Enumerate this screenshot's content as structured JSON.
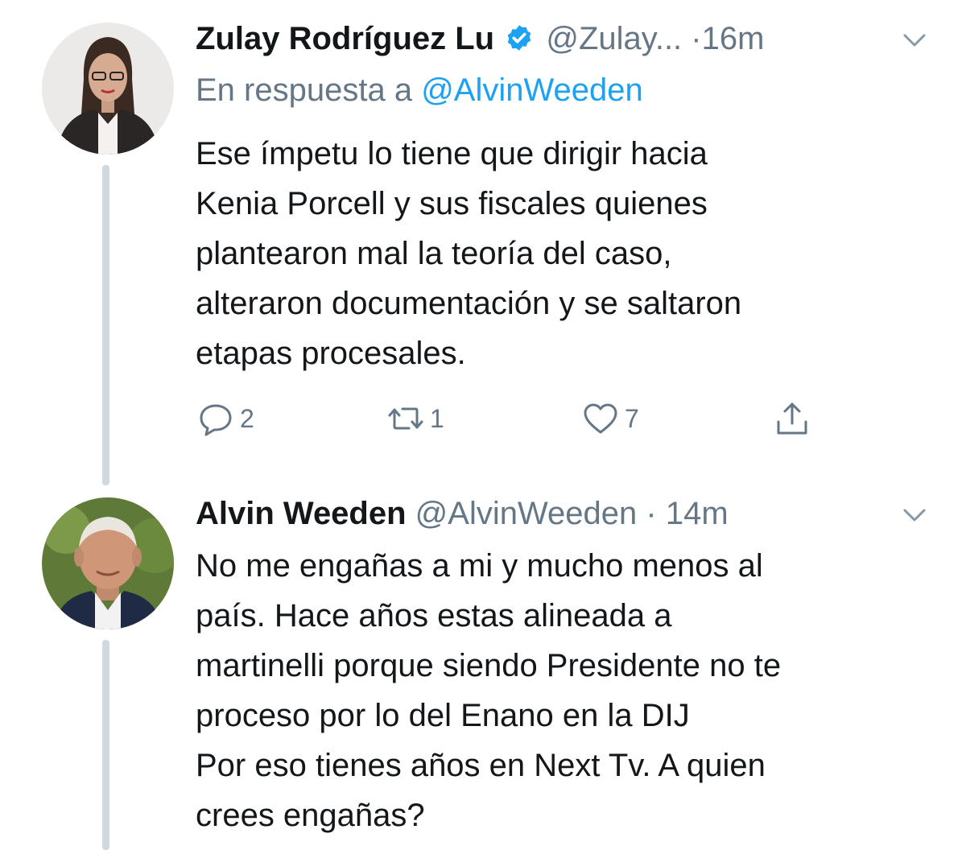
{
  "tweets": [
    {
      "name": "Zulay Rodríguez Lu",
      "handle": "@Zulay...",
      "separator": "·",
      "time": "16m",
      "reply_prefix": "En respuesta a",
      "reply_handle": "@AlvinWeeden",
      "text": "Ese ímpetu lo tiene que dirigir hacia\nKenia Porcell y sus fiscales quienes\nplantearon mal la teoría del caso,\nalteraron documentación y se saltaron\netapas procesales.",
      "replies": "2",
      "retweets": "1",
      "likes": "7",
      "icons": {
        "verified": "verified-badge-icon",
        "reply": "reply-bubble-icon",
        "retweet": "retweet-arrows-icon",
        "like": "heart-icon",
        "share": "share-upload-icon",
        "menu": "chevron-down-icon"
      }
    },
    {
      "name": "Alvin Weeden",
      "handle": "@AlvinWeeden",
      "separator": "·",
      "time": "14m",
      "text": "No me engañas a mi y mucho menos al\npaís. Hace años estas alineada a\nmartinelli porque siendo Presidente no te\nproceso por lo del Enano en la DIJ\nPor eso tienes años en Next Tv. A quien\ncrees engañas?",
      "icons": {
        "menu": "chevron-down-icon"
      }
    }
  ],
  "colors": {
    "accent": "#1da1f2",
    "muted": "#657786",
    "text": "#14171a",
    "thread_line": "#cfd9de"
  }
}
